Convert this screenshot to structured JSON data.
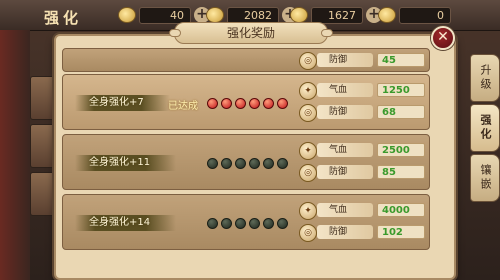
{
  "topbar": {
    "title": "强化",
    "resources": [
      {
        "value": "40"
      },
      {
        "value": "2082"
      },
      {
        "value": "1627"
      },
      {
        "value": "0"
      }
    ]
  },
  "side_tabs": [
    "升级",
    "强化",
    "镶嵌"
  ],
  "dialog": {
    "title": "强化奖励",
    "close_icon": "close-icon"
  },
  "rows": [
    {
      "partial": true,
      "stats": [
        {
          "name": "防御",
          "value": "45"
        }
      ]
    },
    {
      "label": "全身强化+7",
      "status": "已达成",
      "achieved": true,
      "gems_on": 6,
      "gems_total": 6,
      "stats": [
        {
          "name": "气血",
          "value": "1250"
        },
        {
          "name": "防御",
          "value": "68"
        }
      ]
    },
    {
      "label": "全身强化+11",
      "status": "",
      "achieved": false,
      "gems_on": 0,
      "gems_total": 6,
      "stats": [
        {
          "name": "气血",
          "value": "2500"
        },
        {
          "name": "防御",
          "value": "85"
        }
      ]
    },
    {
      "label": "全身强化+14",
      "status": "",
      "achieved": false,
      "gems_on": 0,
      "gems_total": 6,
      "stats": [
        {
          "name": "气血",
          "value": "4000"
        },
        {
          "name": "防御",
          "value": "102"
        }
      ]
    }
  ]
}
